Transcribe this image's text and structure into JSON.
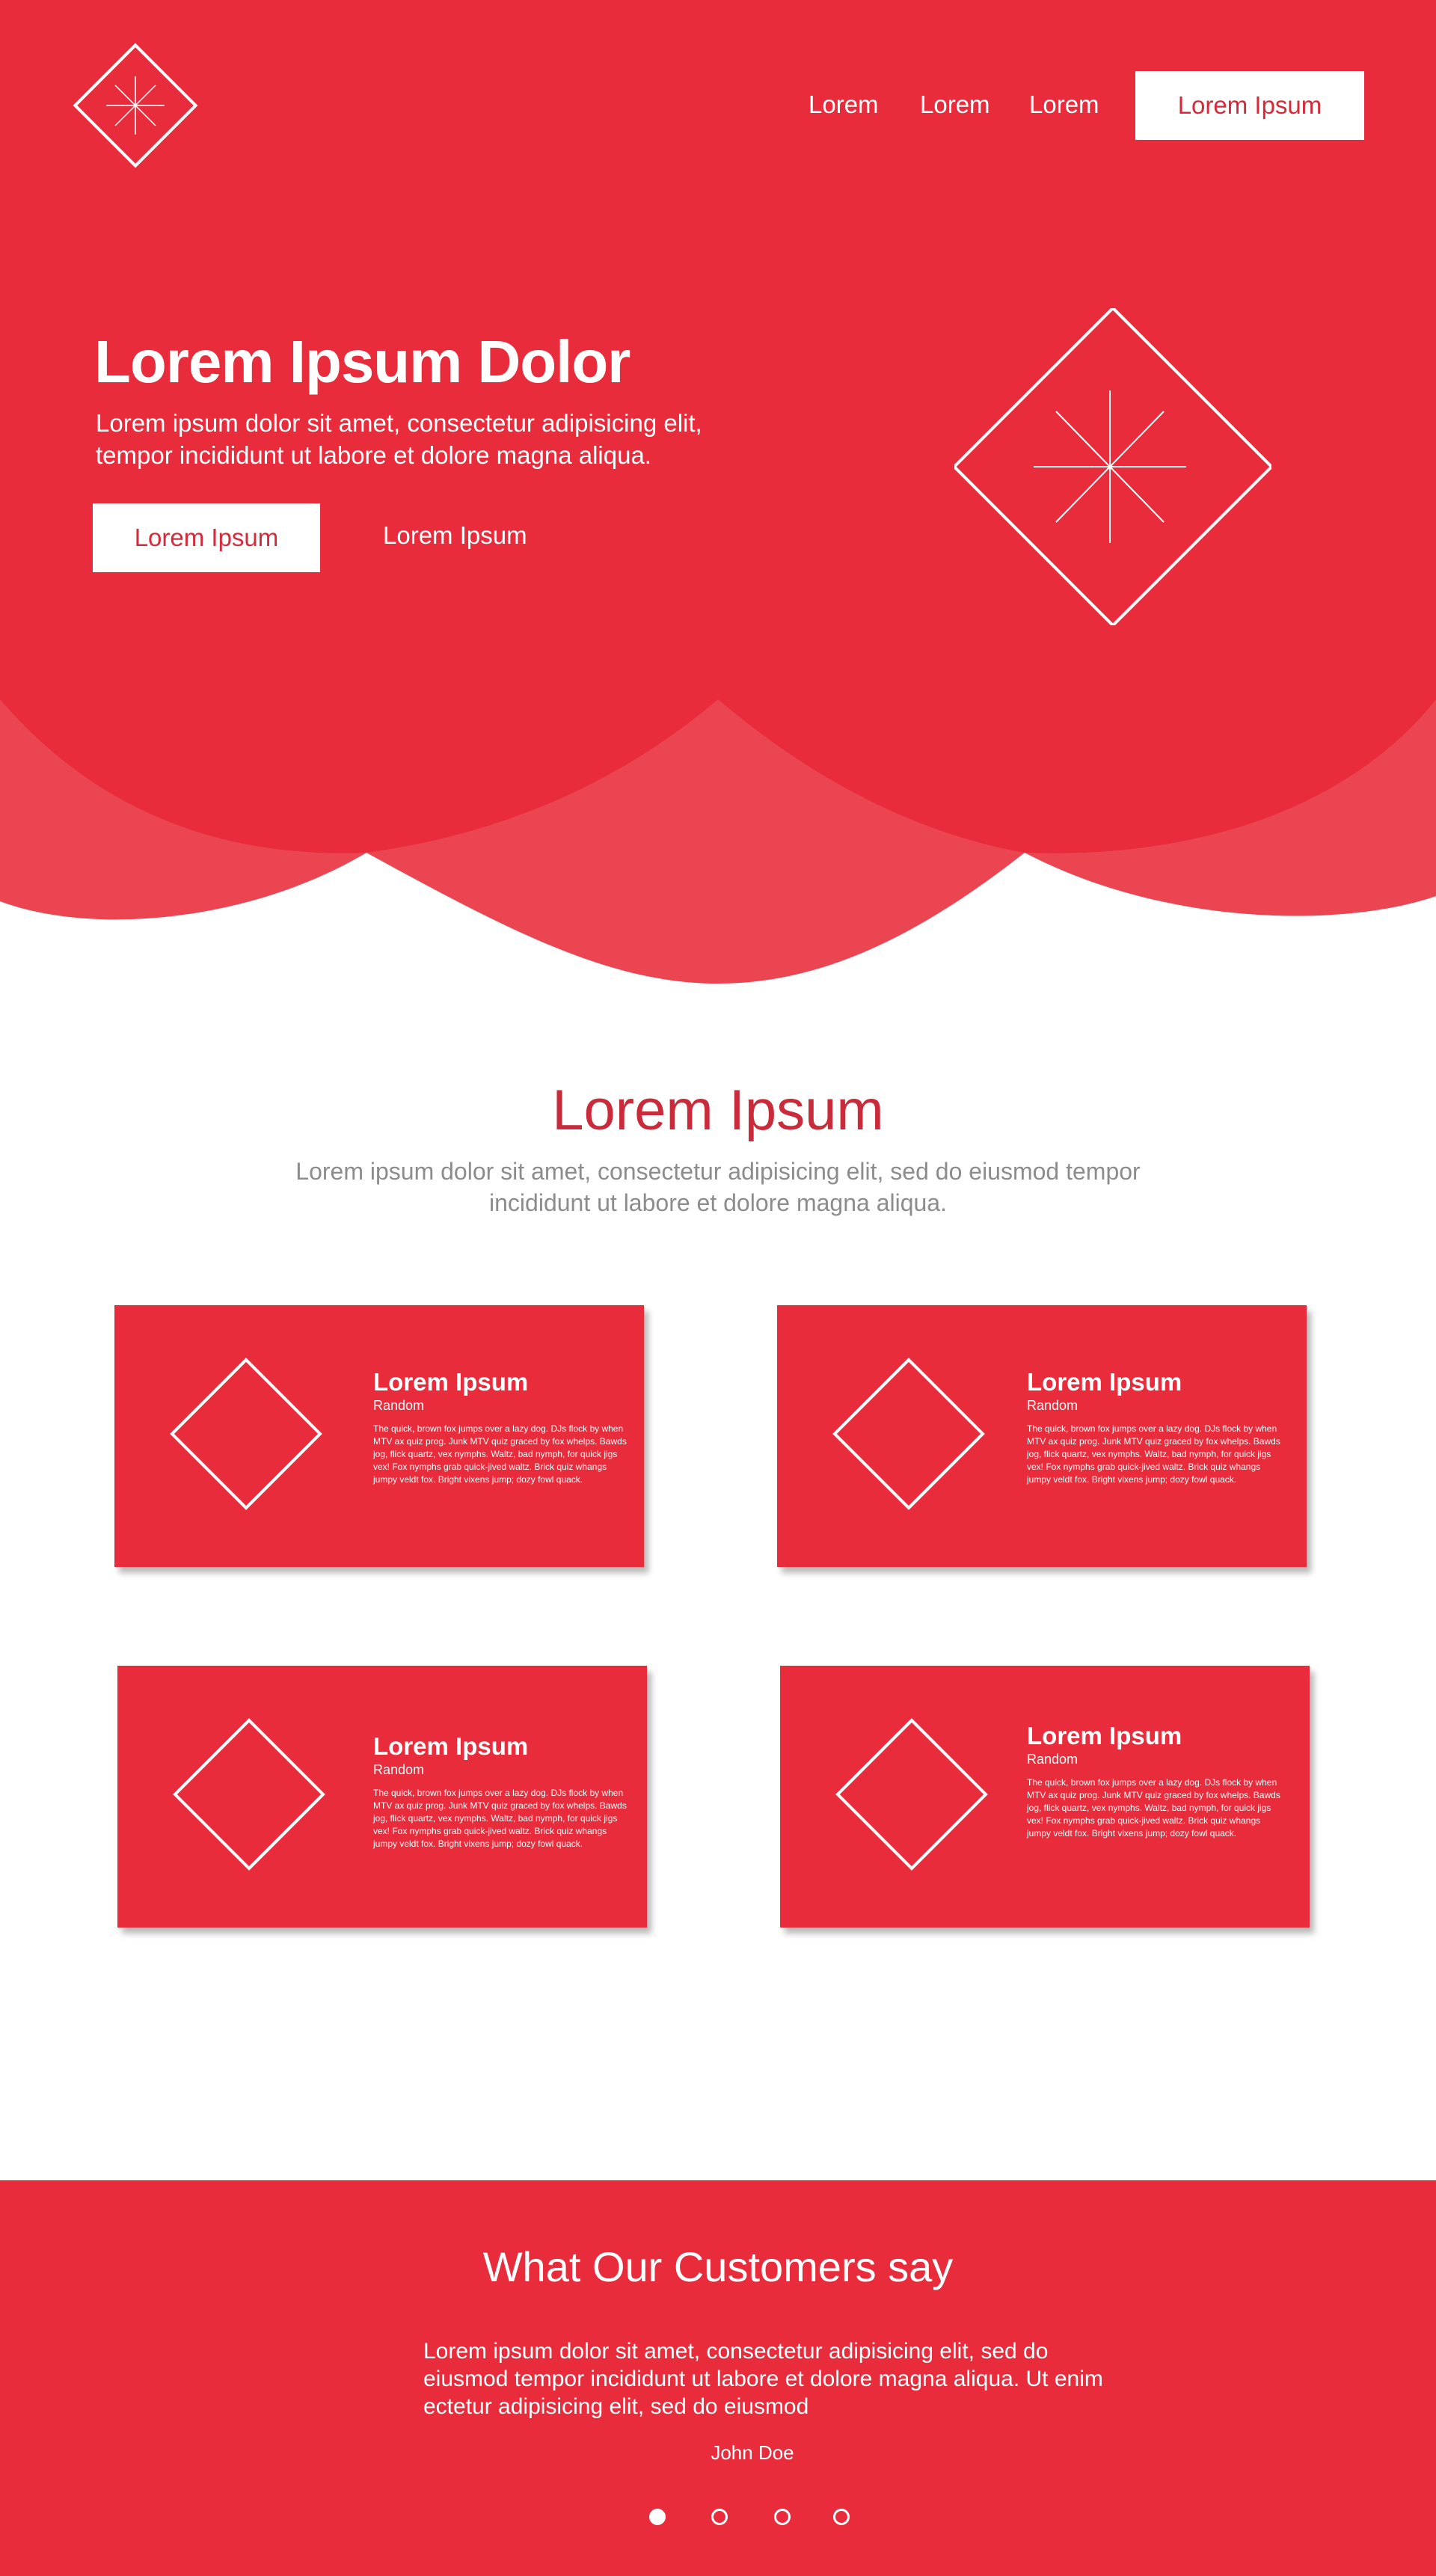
{
  "colors": {
    "primary": "#e82c3c",
    "wave_light": "#ec4552",
    "heading_red": "#c92b3a",
    "muted_text": "#8c8c8c",
    "white": "#ffffff"
  },
  "header": {
    "logo_icon": "diamond-asterisk-icon",
    "nav": [
      "Lorem",
      "Lorem",
      "Lorem"
    ],
    "cta_label": "Lorem Ipsum"
  },
  "hero": {
    "title": "Lorem Ipsum Dolor",
    "subtitle": "Lorem ipsum dolor sit amet, consectetur adipisicing elit, tempor incididunt ut labore et dolore magna aliqua.",
    "primary_button": "Lorem Ipsum",
    "secondary_button": "Lorem Ipsum",
    "graphic_icon": "diamond-asterisk-icon"
  },
  "features": {
    "title": "Lorem Ipsum",
    "subtitle": "Lorem ipsum dolor sit amet, consectetur adipisicing elit, sed do eiusmod tempor incididunt ut labore et dolore magna aliqua.",
    "cards": [
      {
        "title": "Lorem Ipsum",
        "subtitle": "Random",
        "body": "The quick, brown fox jumps over a lazy dog. DJs flock by when MTV ax quiz prog. Junk MTV quiz graced by fox whelps. Bawds jog, flick quartz, vex nymphs. Waltz, bad nymph, for quick jigs vex! Fox nymphs grab quick-jived waltz. Brick quiz whangs jumpy veldt fox. Bright vixens jump; dozy fowl quack.",
        "icon": "diamond-icon"
      },
      {
        "title": "Lorem Ipsum",
        "subtitle": "Random",
        "body": "The quick, brown fox jumps over a lazy dog. DJs flock by when MTV ax quiz prog. Junk MTV quiz graced by fox whelps. Bawds jog, flick quartz, vex nymphs. Waltz, bad nymph, for quick jigs vex! Fox nymphs grab quick-jived waltz. Brick quiz whangs jumpy veldt fox. Bright vixens jump; dozy fowl quack.",
        "icon": "diamond-icon"
      },
      {
        "title": "Lorem Ipsum",
        "subtitle": "Random",
        "body": "The quick, brown fox jumps over a lazy dog. DJs flock by when MTV ax quiz prog. Junk MTV quiz graced by fox whelps. Bawds jog, flick quartz, vex nymphs. Waltz, bad nymph, for quick jigs vex! Fox nymphs grab quick-jived waltz. Brick quiz whangs jumpy veldt fox. Bright vixens jump; dozy fowl quack.",
        "icon": "diamond-icon"
      },
      {
        "title": "Lorem Ipsum",
        "subtitle": "Random",
        "body": "The quick, brown fox jumps over a lazy dog. DJs flock by when MTV ax quiz prog. Junk MTV quiz graced by fox whelps. Bawds jog, flick quartz, vex nymphs. Waltz, bad nymph, for quick jigs vex! Fox nymphs grab quick-jived waltz. Brick quiz whangs jumpy veldt fox. Bright vixens jump; dozy fowl quack.",
        "icon": "diamond-icon"
      }
    ]
  },
  "testimonials": {
    "title": "What Our Customers say",
    "quote": "Lorem ipsum dolor sit amet, consectetur adipisicing elit, sed do eiusmod tempor incididunt ut labore et dolore magna aliqua. Ut enim ectetur adipisicing elit, sed do eiusmod",
    "author": "John Doe",
    "carousel": {
      "slide_count": 4,
      "active_slide": 1
    }
  }
}
